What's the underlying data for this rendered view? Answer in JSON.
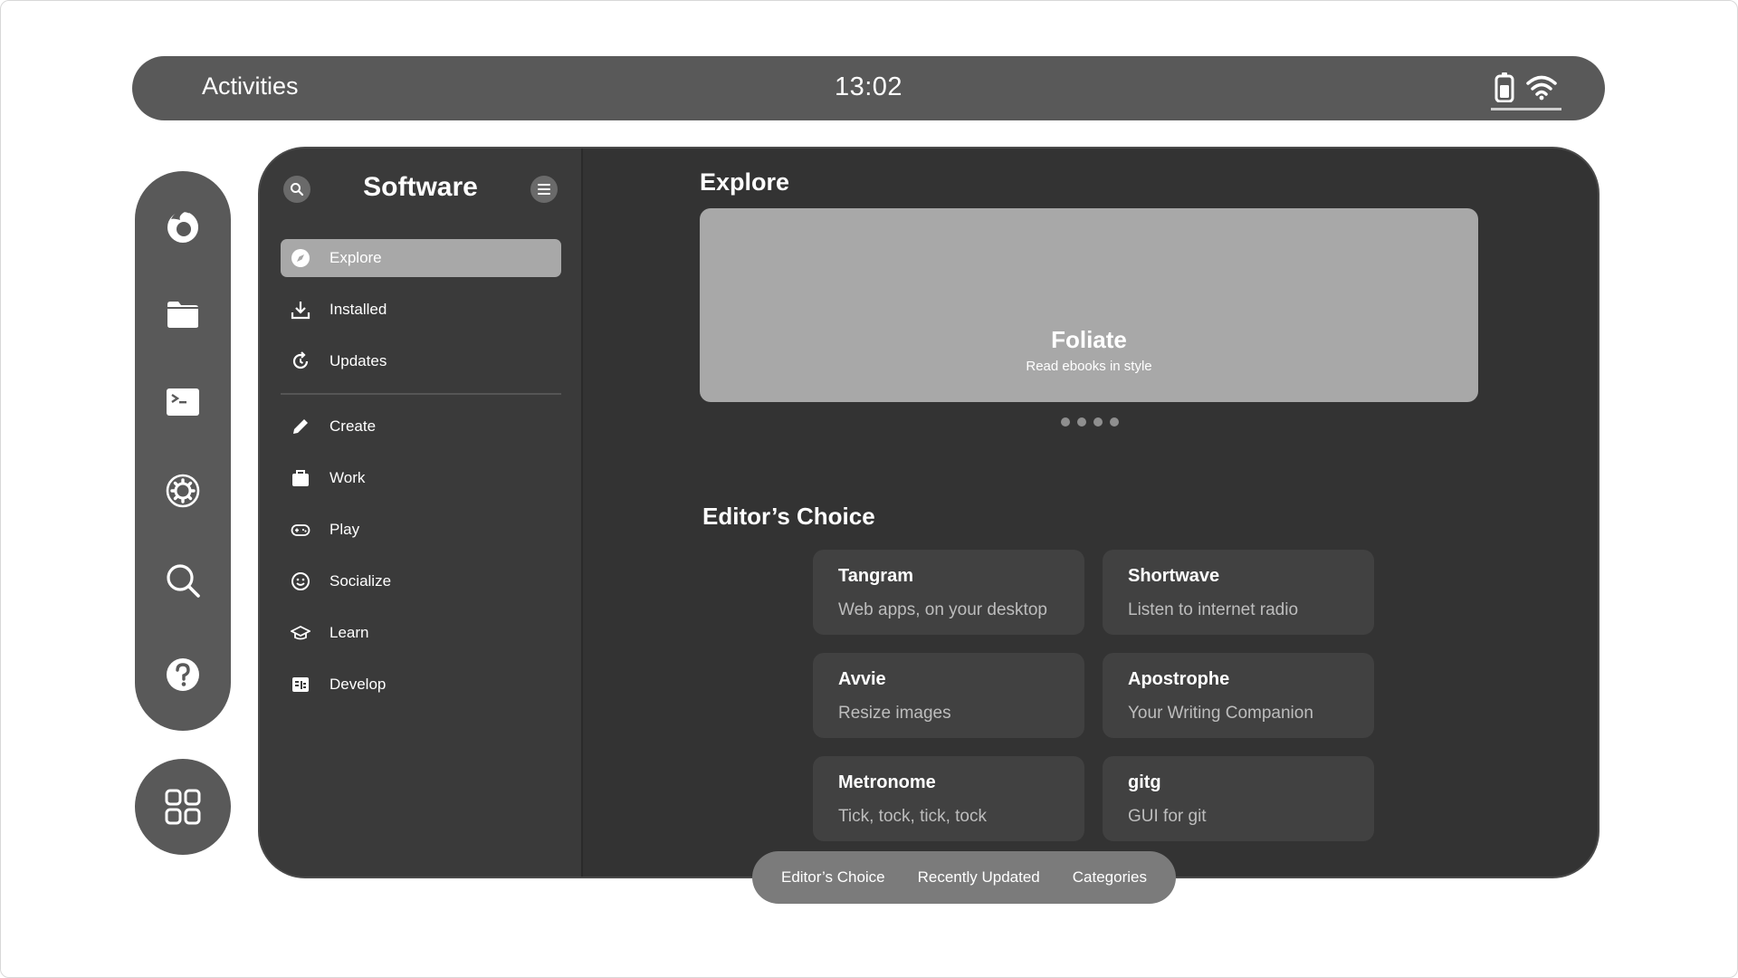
{
  "topbar": {
    "activities_label": "Activities",
    "clock": "13:02",
    "tray_icons": [
      "battery-icon",
      "wifi-icon"
    ]
  },
  "dock": {
    "items": [
      {
        "icon": "firefox-icon"
      },
      {
        "icon": "files-icon"
      },
      {
        "icon": "terminal-icon"
      },
      {
        "icon": "settings-icon"
      },
      {
        "icon": "search-icon"
      },
      {
        "icon": "help-icon"
      }
    ],
    "apps_icon": "app-grid-icon"
  },
  "sidebar": {
    "title": "Software",
    "items": [
      {
        "label": "Explore",
        "icon": "compass-icon",
        "active": true
      },
      {
        "label": "Installed",
        "icon": "download-icon"
      },
      {
        "label": "Updates",
        "icon": "refresh-icon"
      },
      {
        "label": "Create",
        "icon": "pencil-icon"
      },
      {
        "label": "Work",
        "icon": "briefcase-icon"
      },
      {
        "label": "Play",
        "icon": "gamepad-icon"
      },
      {
        "label": "Socialize",
        "icon": "smiley-icon"
      },
      {
        "label": "Learn",
        "icon": "graduation-cap-icon"
      },
      {
        "label": "Develop",
        "icon": "code-icon"
      }
    ]
  },
  "main": {
    "title": "Explore",
    "banner": {
      "name": "Foliate",
      "description": "Read ebooks in style"
    },
    "carousel_dot_count": 4,
    "editors_choice": {
      "title": "Editor’s Choice",
      "apps": [
        {
          "name": "Tangram",
          "description": "Web apps, on your desktop"
        },
        {
          "name": "Shortwave",
          "description": "Listen to internet radio"
        },
        {
          "name": "Avvie",
          "description": "Resize images"
        },
        {
          "name": "Apostrophe",
          "description": "Your Writing Companion"
        },
        {
          "name": "Metronome",
          "description": "Tick, tock, tick, tock"
        },
        {
          "name": "gitg",
          "description": "GUI for git"
        }
      ]
    }
  },
  "switcher": {
    "tabs": [
      "Editor’s Choice",
      "Recently Updated",
      "Categories"
    ]
  },
  "colors": {
    "panel": "#595959",
    "window": "#333333",
    "sidebar": "#3a3a3a",
    "active_item": "#a8a8a8",
    "card": "#414141",
    "switcher": "#7b7b7b"
  }
}
